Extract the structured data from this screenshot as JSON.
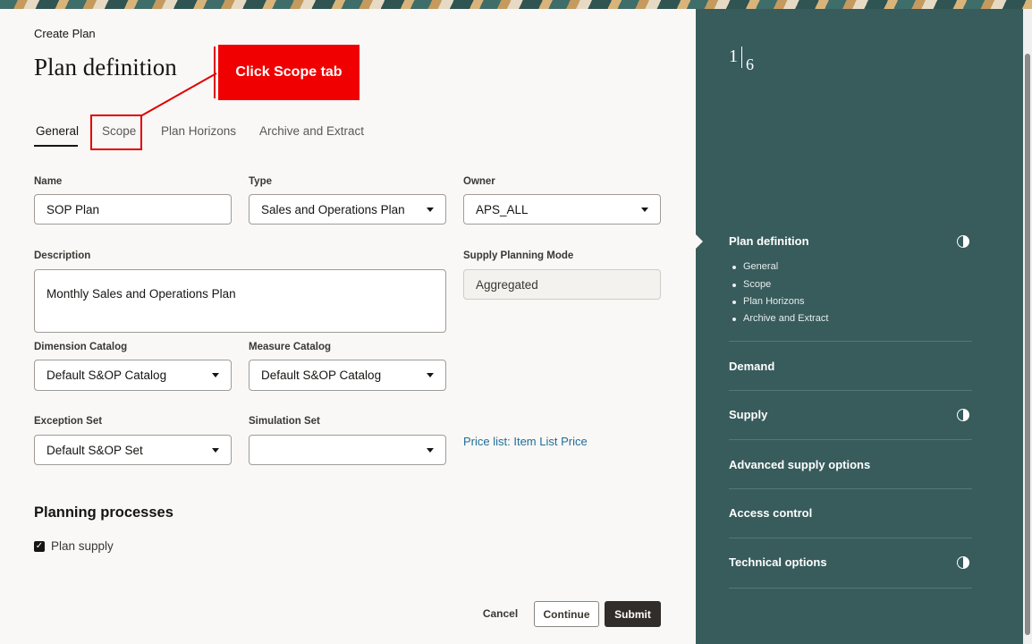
{
  "breadcrumb": "Create Plan",
  "page_title": "Plan definition",
  "callout": "Click Scope tab",
  "tabs": [
    {
      "label": "General"
    },
    {
      "label": "Scope"
    },
    {
      "label": "Plan Horizons"
    },
    {
      "label": "Archive and Extract"
    }
  ],
  "form": {
    "name": {
      "label": "Name",
      "value": "SOP Plan"
    },
    "type": {
      "label": "Type",
      "value": "Sales and Operations Plan"
    },
    "owner": {
      "label": "Owner",
      "value": "APS_ALL"
    },
    "description": {
      "label": "Description",
      "value": "Monthly Sales and Operations Plan"
    },
    "supply_mode": {
      "label": "Supply Planning Mode",
      "value": "Aggregated"
    },
    "dimension_catalog": {
      "label": "Dimension Catalog",
      "value": "Default S&OP Catalog"
    },
    "measure_catalog": {
      "label": "Measure Catalog",
      "value": "Default S&OP Catalog"
    },
    "exception_set": {
      "label": "Exception Set",
      "value": "Default S&OP Set"
    },
    "simulation_set": {
      "label": "Simulation Set",
      "value": ""
    },
    "price_list_link": "Price list: Item List Price"
  },
  "planning_processes": {
    "heading": "Planning processes",
    "plan_supply": {
      "label": "Plan supply",
      "checked": true
    }
  },
  "footer": {
    "cancel": "Cancel",
    "continue": "Continue",
    "submit": "Submit"
  },
  "side_panel": {
    "step_current": "1",
    "step_total": "6",
    "sections": [
      {
        "label": "Plan definition",
        "icon": "half-circle-icon",
        "subitems": [
          "General",
          "Scope",
          "Plan Horizons",
          "Archive and Extract"
        ]
      },
      {
        "label": "Demand"
      },
      {
        "label": "Supply",
        "icon": "half-circle-icon"
      },
      {
        "label": "Advanced supply options"
      },
      {
        "label": "Access control"
      },
      {
        "label": "Technical options",
        "icon": "half-circle-icon"
      }
    ]
  },
  "colors": {
    "side_panel": "#385b5b",
    "callout": "#f00000",
    "link": "#1f6d9b",
    "submit_button": "#312d2a"
  }
}
